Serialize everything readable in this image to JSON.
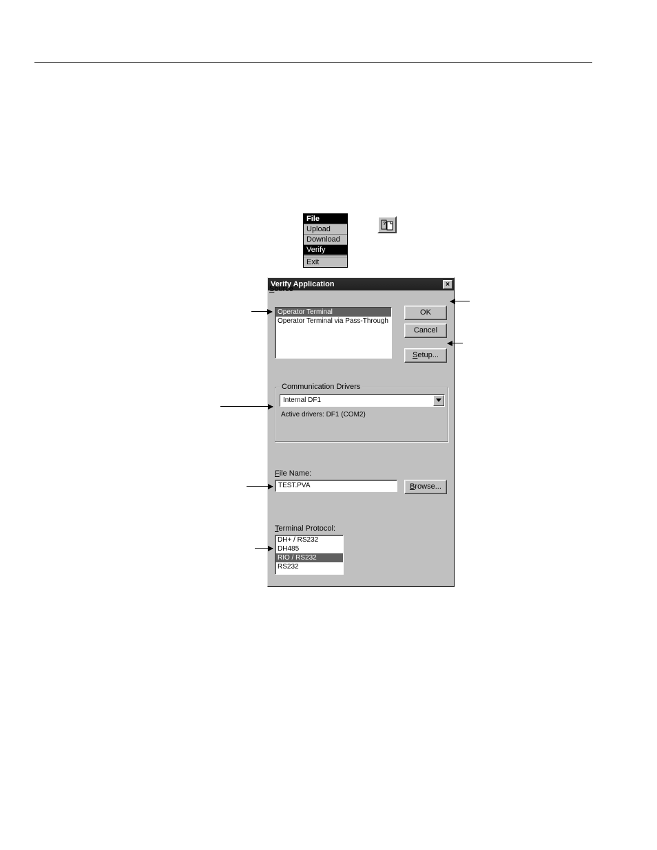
{
  "file_menu": {
    "title": "File",
    "items": [
      "Upload",
      "Download",
      "Verify",
      "Exit"
    ],
    "selected_index": 2
  },
  "toolbar_icon": "verify-icon",
  "dialog": {
    "title": "Verify Application",
    "close_label": "×",
    "source": {
      "label": "Source",
      "options": [
        "Operator Terminal",
        "Operator Terminal via Pass-Through"
      ],
      "selected_index": 0
    },
    "buttons": {
      "ok": "OK",
      "cancel": "Cancel",
      "setup": "Setup...",
      "browse": "Browse..."
    },
    "comm": {
      "legend": "Communication Drivers",
      "combo_value": "Internal DF1",
      "active": "Active drivers: DF1 (COM2)"
    },
    "file": {
      "label": "File Name:",
      "value": "TEST.PVA"
    },
    "protocol": {
      "label": "Terminal Protocol:",
      "options": [
        "DH+ / RS232",
        "DH485",
        "RIO / RS232",
        "RS232"
      ],
      "selected_index": 2
    }
  }
}
